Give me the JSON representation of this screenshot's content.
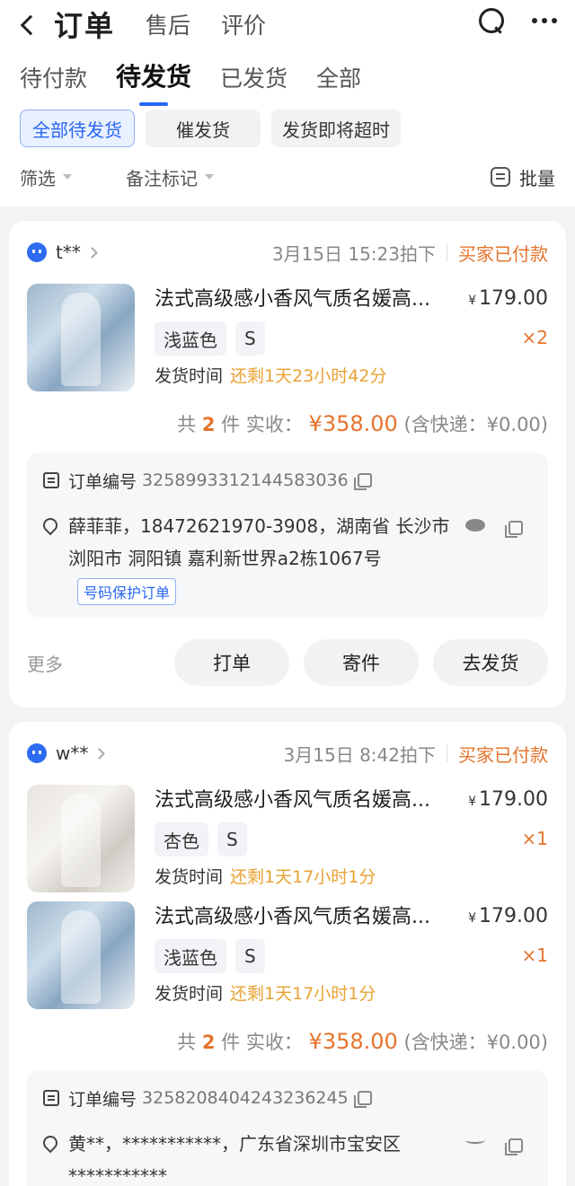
{
  "header": {
    "title": "订单",
    "tabs": [
      "售后",
      "评价"
    ]
  },
  "status_tabs": [
    "待付款",
    "待发货",
    "已发货",
    "全部"
  ],
  "chips": [
    "全部待发货",
    "催发货",
    "发货即将超时"
  ],
  "filters": {
    "filter": "筛选",
    "remark": "备注标记",
    "batch": "批量"
  },
  "orders": [
    {
      "buyer": "t**",
      "time": "3月15日 15:23拍下",
      "status": "买家已付款",
      "items": [
        {
          "title": "法式高级感小香风气质名媛高...",
          "price": "179.00",
          "currency": "¥",
          "qty": "×2",
          "color": "浅蓝色",
          "size": "S",
          "ship_label": "发货时间",
          "ship_remain": "还剩1天23小时42分"
        }
      ],
      "total": {
        "pre": "共",
        "count": "2",
        "mid": "件 实收：",
        "amount": "¥358.00",
        "post": "(含快递：¥0.00)"
      },
      "order_label": "订单编号",
      "order_no": "3258993312144583036",
      "address": "薛菲菲，18472621970-3908，湖南省 长沙市 浏阳市 洞阳镇 嘉利新世界a2栋1067号",
      "protect_tag": "号码保护订单",
      "more": "更多",
      "buttons": [
        "打单",
        "寄件",
        "去发货"
      ]
    },
    {
      "buyer": "w**",
      "time": "3月15日 8:42拍下",
      "status": "买家已付款",
      "items": [
        {
          "title": "法式高级感小香风气质名媛高...",
          "price": "179.00",
          "currency": "¥",
          "qty": "×1",
          "color": "杏色",
          "size": "S",
          "ship_label": "发货时间",
          "ship_remain": "还剩1天17小时1分"
        },
        {
          "title": "法式高级感小香风气质名媛高...",
          "price": "179.00",
          "currency": "¥",
          "qty": "×1",
          "color": "浅蓝色",
          "size": "S",
          "ship_label": "发货时间",
          "ship_remain": "还剩1天17小时1分"
        }
      ],
      "total": {
        "pre": "共",
        "count": "2",
        "mid": "件 实收：",
        "amount": "¥358.00",
        "post": "(含快递：¥0.00)"
      },
      "order_label": "订单编号",
      "order_no": "3258208404243236245",
      "address": "黄**，***********，广东省深圳市宝安区 ***********"
    }
  ],
  "colors": {
    "accent": "#2867f5",
    "orange": "#e5742d",
    "amber": "#e9a233"
  }
}
